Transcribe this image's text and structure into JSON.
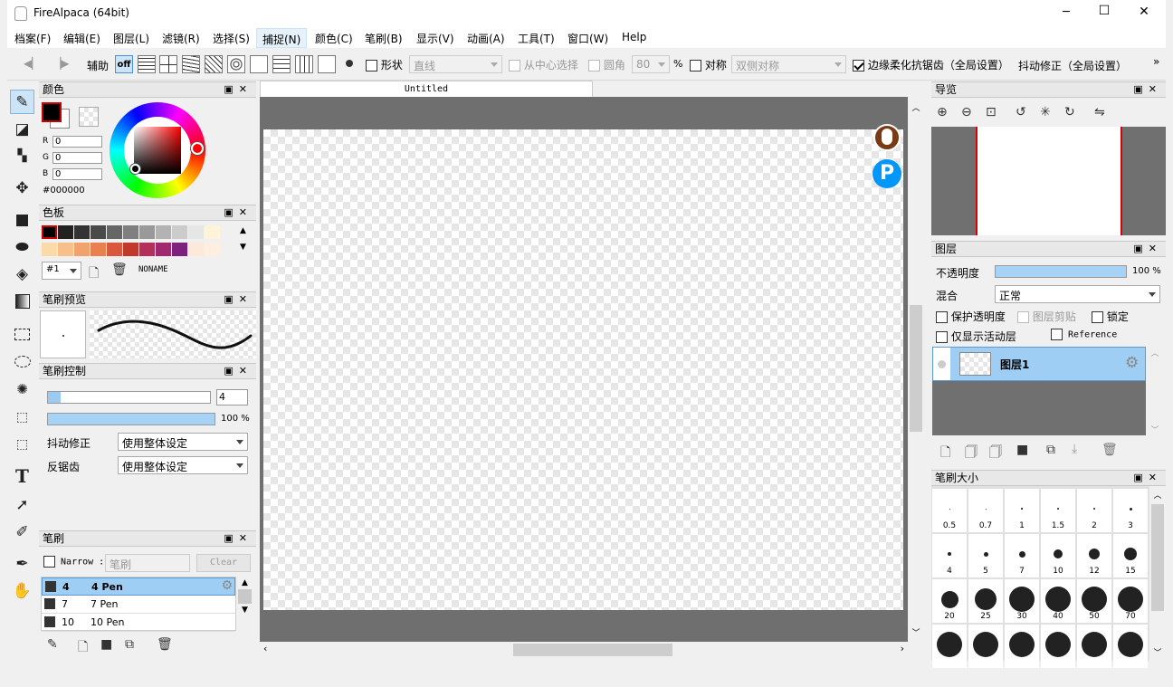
{
  "window": {
    "title": "FireAlpaca (64bit)",
    "controls": {
      "minimize": "─",
      "maximize": "☐",
      "close": "✕"
    }
  },
  "menu": [
    "档案(F)",
    "编辑(E)",
    "图层(L)",
    "滤镜(R)",
    "选择(S)",
    "捕捉(N)",
    "颜色(C)",
    "笔刷(B)",
    "显示(V)",
    "动画(A)",
    "工具(T)",
    "窗口(W)",
    "Help"
  ],
  "toolbar": {
    "assist_label": "辅助",
    "off_label": "off",
    "shape_label": "形状",
    "shape_value": "直线",
    "from_center_label": "从中心选择",
    "round_label": "圆角",
    "round_value": "80",
    "round_unit": "%",
    "symmetry_label": "对称",
    "symmetry_value": "双侧对称",
    "antialias_label": "边缘柔化抗锯齿（全局设置）",
    "stabilizer_label": "抖动修正（全局设置）",
    "more": "»"
  },
  "color_panel": {
    "title": "颜色",
    "r_label": "R",
    "g_label": "G",
    "b_label": "B",
    "r": "0",
    "g": "0",
    "b": "0",
    "hex": "#000000"
  },
  "palette_panel": {
    "title": "色板",
    "palette_id": "#1",
    "palette_name": "NONAME",
    "row1": [
      "#000000",
      "#222222",
      "#333333",
      "#4a4a4a",
      "#666666",
      "#7f7f7f",
      "#999999",
      "#b3b3b3",
      "#cccccc",
      "#e6e6e6",
      "#fff3d9"
    ],
    "row2": [
      "#fcd9a8",
      "#f7c08a",
      "#f2a36b",
      "#e88050",
      "#d9583e",
      "#c0392b",
      "#b3305a",
      "#a0286e",
      "#80207e",
      "#fde9d9",
      "#fcefe0"
    ]
  },
  "brush_preview_panel": {
    "title": "笔刷预览"
  },
  "brush_control_panel": {
    "title": "笔刷控制",
    "size": "4",
    "opacity": "100",
    "opacity_unit": "%",
    "stabilizer_label": "抖动修正",
    "stabilizer_value": "使用整体设定",
    "antialias_label": "反锯齿",
    "antialias_value": "使用整体设定"
  },
  "brush_panel": {
    "title": "笔刷",
    "narrow_label": "Narrow :",
    "search_placeholder": "笔刷",
    "clear_label": "Clear",
    "items": [
      {
        "size": "4",
        "name": "4 Pen"
      },
      {
        "size": "7",
        "name": "7 Pen"
      },
      {
        "size": "10",
        "name": "10 Pen"
      }
    ]
  },
  "document": {
    "tab": "Untitled"
  },
  "navigator_panel": {
    "title": "导览"
  },
  "layer_panel": {
    "title": "图层",
    "opacity_label": "不透明度",
    "opacity_value": "100",
    "opacity_unit": "%",
    "blend_label": "混合",
    "blend_value": "正常",
    "protect_alpha": "保护透明度",
    "clipping": "图层剪贴",
    "lock": "锁定",
    "show_active_only": "仅显示活动层",
    "reference": "Reference",
    "layer_name": "图层1"
  },
  "brush_size_panel": {
    "title": "笔刷大小",
    "sizes": [
      {
        "label": "0.5",
        "d": 1
      },
      {
        "label": "0.7",
        "d": 1
      },
      {
        "label": "1",
        "d": 1.5
      },
      {
        "label": "1.5",
        "d": 2
      },
      {
        "label": "2",
        "d": 2.5
      },
      {
        "label": "3",
        "d": 3
      },
      {
        "label": "4",
        "d": 4
      },
      {
        "label": "5",
        "d": 5
      },
      {
        "label": "7",
        "d": 7
      },
      {
        "label": "10",
        "d": 10
      },
      {
        "label": "12",
        "d": 12
      },
      {
        "label": "15",
        "d": 14
      },
      {
        "label": "20",
        "d": 19
      },
      {
        "label": "25",
        "d": 24
      },
      {
        "label": "30",
        "d": 28
      },
      {
        "label": "40",
        "d": 28
      },
      {
        "label": "50",
        "d": 28
      },
      {
        "label": "70",
        "d": 28
      },
      {
        "label": "",
        "d": 28
      },
      {
        "label": "",
        "d": 28
      },
      {
        "label": "",
        "d": 28
      },
      {
        "label": "",
        "d": 28
      },
      {
        "label": "",
        "d": 28
      },
      {
        "label": "",
        "d": 28
      }
    ]
  }
}
